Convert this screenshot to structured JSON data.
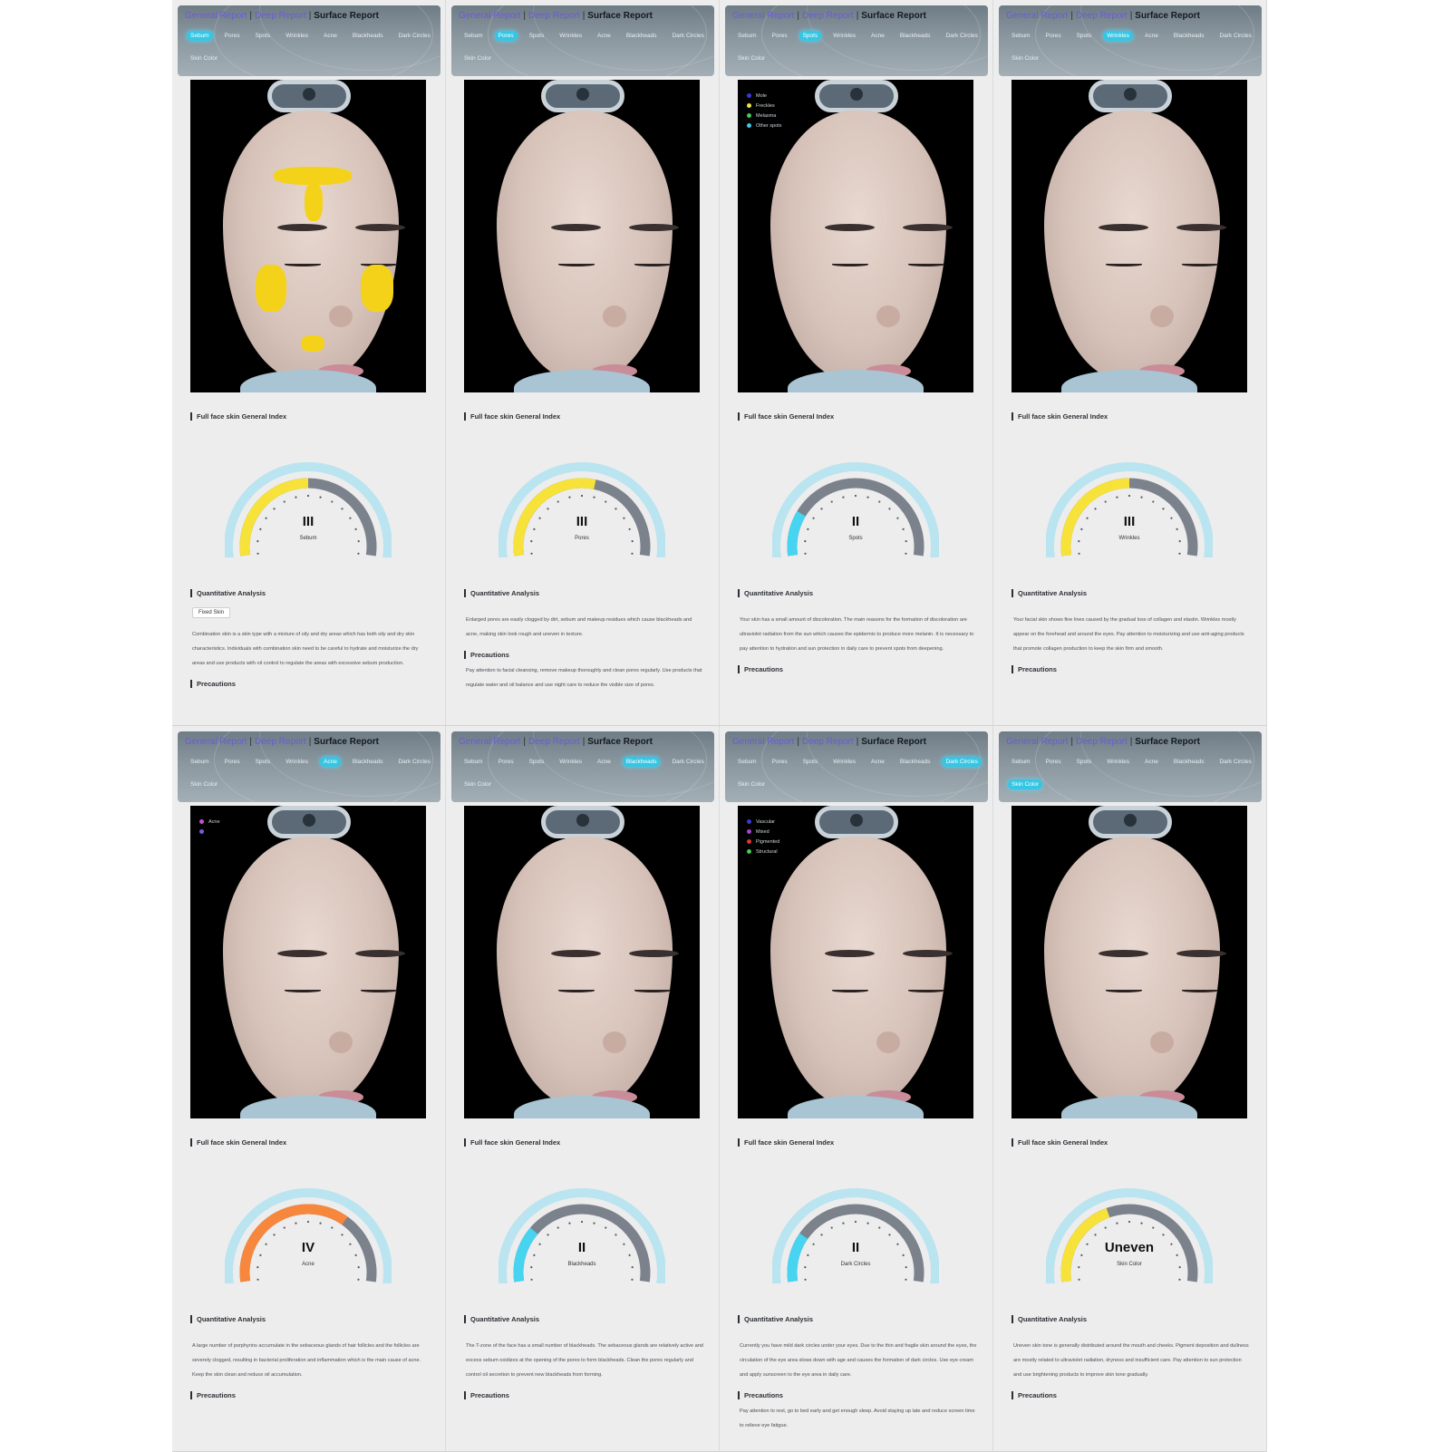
{
  "report_tabs": {
    "general": "General Report",
    "deep": "Deep Report",
    "surface": "Surface Report"
  },
  "tab_labels": [
    "Sebum",
    "Pores",
    "Spots",
    "Wrinkles",
    "Acne",
    "Blackheads",
    "Dark Circles",
    "Skin Color"
  ],
  "section_titles": {
    "index": "Full face skin General Index",
    "quantitative": "Quantitative Analysis",
    "precautions": "Precautions"
  },
  "colors": {
    "level_yellow": "#f7e23a",
    "level_orange": "#f6873c",
    "level_cyan": "#47d4f0",
    "track_gray": "#7b828c",
    "accent_link": "#6a5bd6",
    "active_tab": "#36c6e3"
  },
  "panels": [
    {
      "active_tab": 0,
      "overlay": "sebum-yellow",
      "legend": [],
      "gauge": {
        "value": "III",
        "label": "Sebum",
        "fill_fraction": 0.5,
        "color": "#f7e23a"
      },
      "badge": "Fixed Skin",
      "quantitative_text": "Combination skin is a skin type with a mixture of oily and dry areas which has both oily and dry skin characteristics. Individuals with combination skin need to be careful to hydrate and moisturize the dry areas and use products with oil control to regulate the areas with excessive sebum production.",
      "precautions_text": ""
    },
    {
      "active_tab": 1,
      "overlay": "none",
      "legend": [],
      "gauge": {
        "value": "III",
        "label": "Pores",
        "fill_fraction": 0.56,
        "color": "#f7e23a"
      },
      "badge": "",
      "quantitative_text": "Enlarged pores are easily clogged by dirt, sebum and makeup residues which cause blackheads and acne, making skin look rough and uneven in texture.",
      "precautions_text": "Pay attention to facial cleansing, remove makeup thoroughly and clean pores regularly. Use products that regulate water and oil balance and use night care to reduce the visible size of pores."
    },
    {
      "active_tab": 2,
      "overlay": "none",
      "legend": [
        {
          "label": "Mole",
          "color": "#3a3ad8"
        },
        {
          "label": "Freckles",
          "color": "#f2e640"
        },
        {
          "label": "Melasma",
          "color": "#48c855"
        },
        {
          "label": "Other spots",
          "color": "#40c8e8"
        }
      ],
      "gauge": {
        "value": "II",
        "label": "Spots",
        "fill_fraction": 0.2,
        "color": "#47d4f0"
      },
      "badge": "",
      "quantitative_text": "Your skin has a small amount of discoloration. The main reasons for the formation of discoloration are ultraviolet radiation from the sun which causes the epidermis to produce more melanin. It is necessary to pay attention to hydration and sun protection in daily care to prevent spots from deepening.",
      "precautions_text": ""
    },
    {
      "active_tab": 3,
      "overlay": "none",
      "legend": [],
      "gauge": {
        "value": "III",
        "label": "Wrinkles",
        "fill_fraction": 0.5,
        "color": "#f7e23a"
      },
      "badge": "",
      "quantitative_text": "Your facial skin shows fine lines caused by the gradual loss of collagen and elastin. Wrinkles mostly appear on the forehead and around the eyes. Pay attention to moisturizing and use anti-aging products that promote collagen production to keep the skin firm and smooth.",
      "precautions_text": ""
    },
    {
      "active_tab": 4,
      "overlay": "none",
      "legend": [
        {
          "label": "Acne",
          "color": "#c052d8"
        },
        {
          "label": "",
          "color": "#7a5ae0"
        }
      ],
      "gauge": {
        "value": "IV",
        "label": "Acne",
        "fill_fraction": 0.68,
        "color": "#f6873c"
      },
      "badge": "",
      "quantitative_text": "A large number of porphyrins accumulate in the sebaceous glands of hair follicles and the follicles are severely clogged, resulting in bacterial proliferation and inflammation which is the main cause of acne. Keep the skin clean and reduce oil accumulation.",
      "precautions_text": ""
    },
    {
      "active_tab": 5,
      "overlay": "none",
      "legend": [],
      "gauge": {
        "value": "II",
        "label": "Blackheads",
        "fill_fraction": 0.25,
        "color": "#47d4f0"
      },
      "badge": "",
      "quantitative_text": "The T-zone of the face has a small number of blackheads. The sebaceous glands are relatively active and excess sebum oxidizes at the opening of the pores to form blackheads. Clean the pores regularly and control oil secretion to prevent new blackheads from forming.",
      "precautions_text": ""
    },
    {
      "active_tab": 6,
      "overlay": "none",
      "legend": [
        {
          "label": "Vascular",
          "color": "#3a3ad8"
        },
        {
          "label": "Mixed",
          "color": "#b040d0"
        },
        {
          "label": "Pigmented",
          "color": "#e03535"
        },
        {
          "label": "Structural",
          "color": "#48c855"
        }
      ],
      "gauge": {
        "value": "II",
        "label": "Dark Circles",
        "fill_fraction": 0.22,
        "color": "#47d4f0"
      },
      "badge": "",
      "quantitative_text": "Currently you have mild dark circles under your eyes. Due to the thin and fragile skin around the eyes, the circulation of the eye area slows down with age and causes the formation of dark circles. Use eye cream and apply sunscreen to the eye area in daily care.",
      "precautions_text": "Pay attention to rest, go to bed early and get enough sleep. Avoid staying up late and reduce screen time to relieve eye fatigue."
    },
    {
      "active_tab": 7,
      "overlay": "none",
      "legend": [],
      "gauge": {
        "value": "Uneven",
        "label": "Skin Color",
        "fill_fraction": 0.4,
        "color": "#f7e23a"
      },
      "badge": "",
      "quantitative_text": "Uneven skin tone is generally distributed around the mouth and cheeks. Pigment deposition and dullness are mostly related to ultraviolet radiation, dryness and insufficient care. Pay attention to sun protection and use brightening products to improve skin tone gradually.",
      "precautions_text": ""
    }
  ]
}
